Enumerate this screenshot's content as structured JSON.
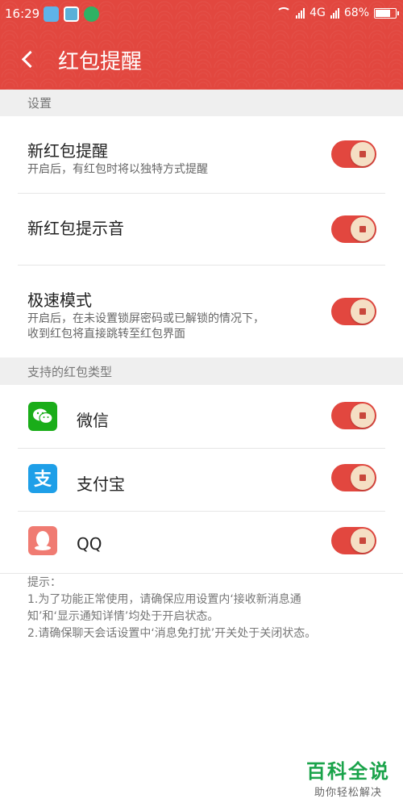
{
  "status_bar": {
    "time": "16:29",
    "network": "4G",
    "battery": "68%",
    "battery_level": 0.68
  },
  "nav": {
    "title": "红包提醒"
  },
  "sections": {
    "settings": "设置",
    "supported": "支持的红包类型"
  },
  "settings": [
    {
      "title": "新红包提醒",
      "subtitle": "开启后，有红包时将以独特方式提醒",
      "enabled": true
    },
    {
      "title": "新红包提示音",
      "subtitle": "",
      "enabled": true
    },
    {
      "title": "极速模式",
      "subtitle_lines": [
        "开启后，在未设置锁屏密码或已解锁的情况下，",
        "收到红包将直接跳转至红包界面"
      ],
      "enabled": true
    }
  ],
  "apps": [
    {
      "name": "微信",
      "icon": "wechat-icon",
      "enabled": true
    },
    {
      "name": "支付宝",
      "icon": "alipay-icon",
      "enabled": true
    },
    {
      "name": "QQ",
      "icon": "qq-icon",
      "enabled": true
    }
  ],
  "tips": {
    "heading": "提示：",
    "lines": [
      "1.为了功能正常使用，请确保应用设置内‘接收新消息通",
      "知’和‘显示通知详情’均处于开启状态。",
      "2.请确保聊天会话设置中‘消息免打扰’开关处于关闭状态。"
    ]
  },
  "watermark": {
    "title": "百科全说",
    "subtitle": "助你轻松解决"
  },
  "colors": {
    "accent": "#e2473f",
    "wechat": "#1aad19",
    "alipay": "#1e9fe8",
    "qq": "#f07b72"
  }
}
